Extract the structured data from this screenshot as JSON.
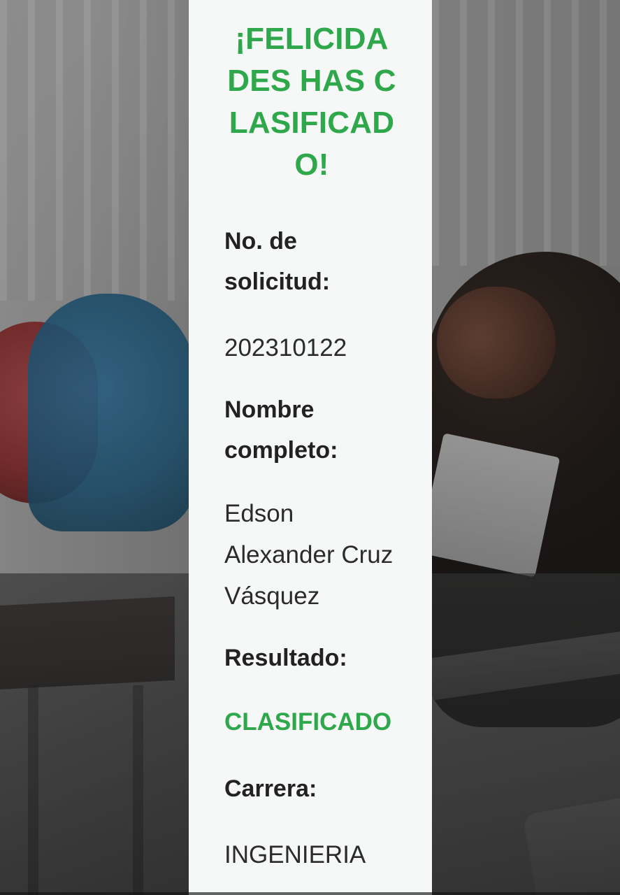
{
  "card": {
    "title": "¡FELICIDADES HAS CLASIFICADO!",
    "fields": {
      "application_number": {
        "label": "No. de solicitud:",
        "value": "202310122"
      },
      "full_name": {
        "label": "Nombre completo:",
        "value": "Edson Alexander Cruz Vásquez"
      },
      "result": {
        "label": "Resultado:",
        "value": "CLASIFICADO"
      },
      "career": {
        "label": "Carrera:",
        "value": "INGENIERIA"
      }
    }
  },
  "colors": {
    "accent_green": "#2ea84a",
    "card_background": "#f6f8f8",
    "text_dark": "#222222"
  }
}
